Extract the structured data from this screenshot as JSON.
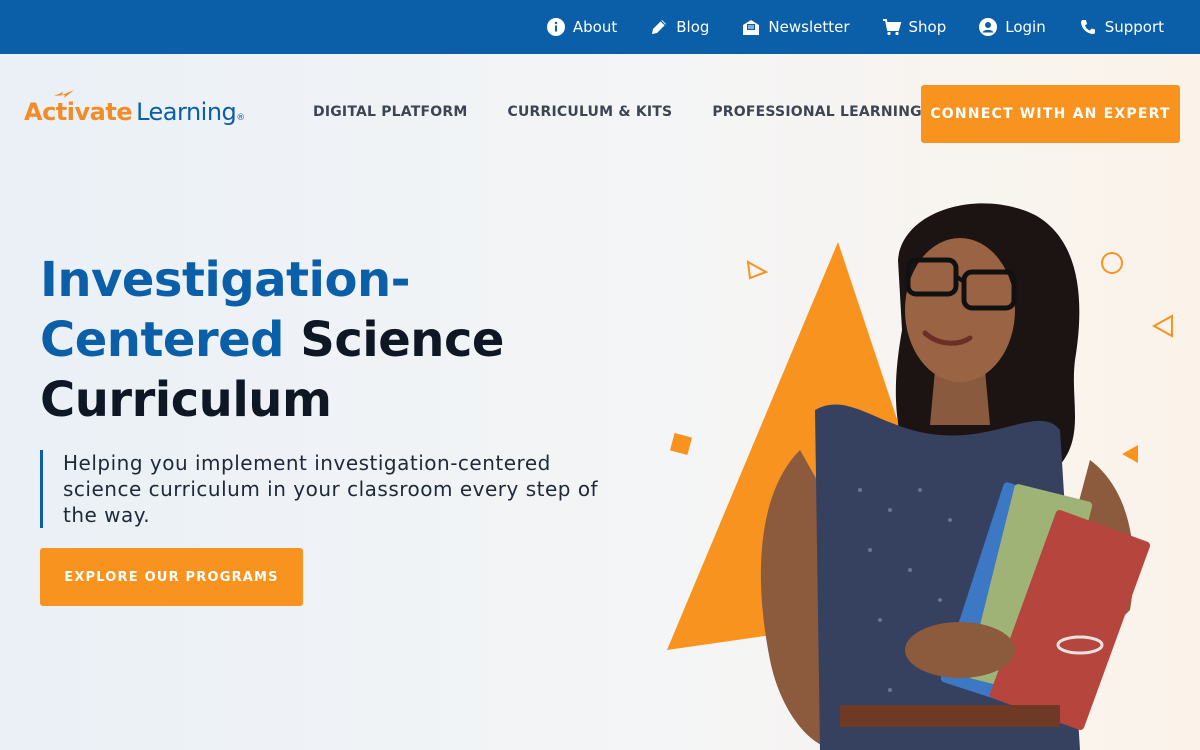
{
  "utility_nav": {
    "items": [
      {
        "label": "About",
        "icon": "info-icon"
      },
      {
        "label": "Blog",
        "icon": "pencil-icon"
      },
      {
        "label": "Newsletter",
        "icon": "newsletter-icon"
      },
      {
        "label": "Shop",
        "icon": "cart-icon"
      },
      {
        "label": "Login",
        "icon": "user-icon"
      },
      {
        "label": "Support",
        "icon": "phone-icon"
      }
    ]
  },
  "brand": {
    "logo_part1": "Activate",
    "logo_part2": "Learning",
    "logo_reg": "®"
  },
  "main_nav": {
    "items": [
      "DIGITAL PLATFORM",
      "CURRICULUM & KITS",
      "PROFESSIONAL LEARNING"
    ]
  },
  "header_cta": "CONNECT WITH AN EXPERT",
  "hero": {
    "title_blue_1": "Investigation-",
    "title_blue_2": "Centered",
    "title_dark_1": "Science",
    "title_dark_2": "Curriculum",
    "subtitle": "Helping you implement investigation-centered science curriculum in your classroom every step of the way.",
    "cta": "EXPLORE OUR PROGRAMS"
  },
  "colors": {
    "primary_blue": "#0a5fa8",
    "accent_orange": "#f7931e",
    "dark_text": "#0f1724"
  }
}
